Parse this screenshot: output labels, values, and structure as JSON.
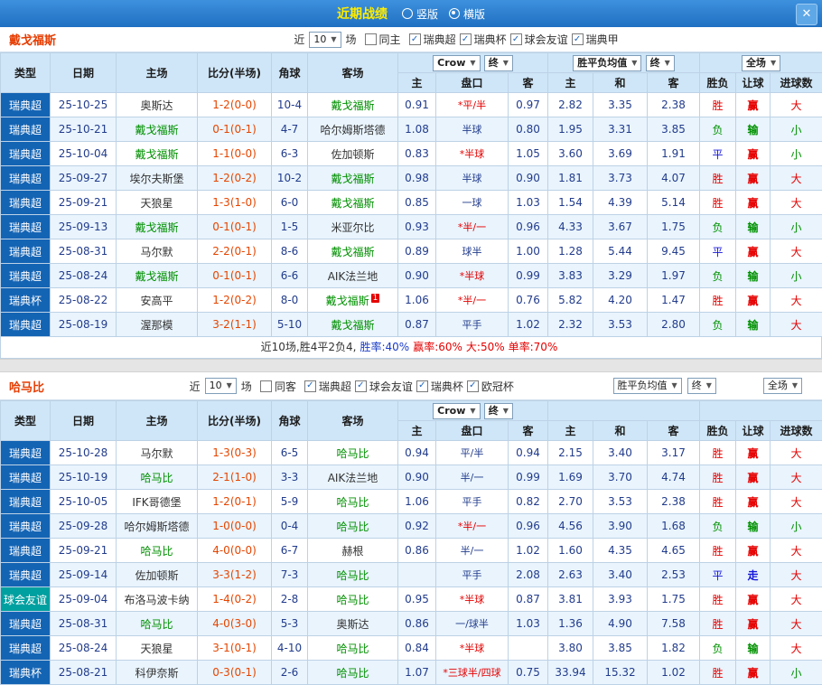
{
  "topbar": {
    "title": "近期战绩",
    "radios": [
      {
        "label": "竖版",
        "checked": false
      },
      {
        "label": "横版",
        "checked": true
      }
    ],
    "close": "✕"
  },
  "header": {
    "near_label": "近",
    "games_label": "场",
    "cols": [
      "类型",
      "日期",
      "主场",
      "比分(半场)",
      "角球",
      "客场"
    ],
    "sub": [
      "主",
      "盘口",
      "客",
      "主",
      "和",
      "客",
      "胜负",
      "让球",
      "进球数"
    ],
    "crow": "Crow",
    "final": "终",
    "avg": "胜平负均值",
    "full": "全场"
  },
  "league_colors": {
    "瑞典超": "#1464b4",
    "瑞典杯": "#1464b4",
    "瑞典甲": "#1464b4",
    "欧冠杯": "#1464b4",
    "球会友谊": "#00a0a0",
    "default": "#1464b4"
  },
  "sections": [
    {
      "team": "戴戈福斯",
      "filter": {
        "count": "10",
        "same_label": "同主",
        "same_checked": false,
        "leagues": [
          {
            "label": "瑞典超",
            "checked": true
          },
          {
            "label": "瑞典杯",
            "checked": true
          },
          {
            "label": "球会友谊",
            "checked": true
          },
          {
            "label": "瑞典甲",
            "checked": true
          }
        ]
      },
      "rows": [
        {
          "league": "瑞典超",
          "date": "25-10-25",
          "home": "奥斯达",
          "home_subject": false,
          "score": "1-2(0-0)",
          "corner": "10-4",
          "away": "戴戈福斯",
          "away_subject": true,
          "badge": "",
          "o1": "0.91",
          "pan": "*平/半",
          "o2": "0.97",
          "a1": "2.82",
          "a2": "3.35",
          "a3": "2.38",
          "r1": "胜",
          "r2": "赢",
          "r3": "大"
        },
        {
          "league": "瑞典超",
          "date": "25-10-21",
          "home": "戴戈福斯",
          "home_subject": true,
          "score": "0-1(0-1)",
          "corner": "4-7",
          "away": "哈尔姆斯塔德",
          "away_subject": false,
          "badge": "",
          "o1": "1.08",
          "pan": "半球",
          "o2": "0.80",
          "a1": "1.95",
          "a2": "3.31",
          "a3": "3.85",
          "r1": "负",
          "r2": "输",
          "r3": "小"
        },
        {
          "league": "瑞典超",
          "date": "25-10-04",
          "home": "戴戈福斯",
          "home_subject": true,
          "score": "1-1(0-0)",
          "corner": "6-3",
          "away": "佐加顿斯",
          "away_subject": false,
          "badge": "",
          "o1": "0.83",
          "pan": "*半球",
          "o2": "1.05",
          "a1": "3.60",
          "a2": "3.69",
          "a3": "1.91",
          "r1": "平",
          "r2": "赢",
          "r3": "小"
        },
        {
          "league": "瑞典超",
          "date": "25-09-27",
          "home": "埃尔夫斯堡",
          "home_subject": false,
          "score": "1-2(0-2)",
          "corner": "10-2",
          "away": "戴戈福斯",
          "away_subject": true,
          "badge": "",
          "o1": "0.98",
          "pan": "半球",
          "o2": "0.90",
          "a1": "1.81",
          "a2": "3.73",
          "a3": "4.07",
          "r1": "胜",
          "r2": "赢",
          "r3": "大"
        },
        {
          "league": "瑞典超",
          "date": "25-09-21",
          "home": "天狼星",
          "home_subject": false,
          "score": "1-3(1-0)",
          "corner": "6-0",
          "away": "戴戈福斯",
          "away_subject": true,
          "badge": "",
          "o1": "0.85",
          "pan": "一球",
          "o2": "1.03",
          "a1": "1.54",
          "a2": "4.39",
          "a3": "5.14",
          "r1": "胜",
          "r2": "赢",
          "r3": "大"
        },
        {
          "league": "瑞典超",
          "date": "25-09-13",
          "home": "戴戈福斯",
          "home_subject": true,
          "score": "0-1(0-1)",
          "corner": "1-5",
          "away": "米亚尔比",
          "away_subject": false,
          "badge": "",
          "o1": "0.93",
          "pan": "*半/一",
          "o2": "0.96",
          "a1": "4.33",
          "a2": "3.67",
          "a3": "1.75",
          "r1": "负",
          "r2": "输",
          "r3": "小"
        },
        {
          "league": "瑞典超",
          "date": "25-08-31",
          "home": "马尔默",
          "home_subject": false,
          "score": "2-2(0-1)",
          "corner": "8-6",
          "away": "戴戈福斯",
          "away_subject": true,
          "badge": "",
          "o1": "0.89",
          "pan": "球半",
          "o2": "1.00",
          "a1": "1.28",
          "a2": "5.44",
          "a3": "9.45",
          "r1": "平",
          "r2": "赢",
          "r3": "大"
        },
        {
          "league": "瑞典超",
          "date": "25-08-24",
          "home": "戴戈福斯",
          "home_subject": true,
          "score": "0-1(0-1)",
          "corner": "6-6",
          "away": "AIK法兰地",
          "away_subject": false,
          "badge": "",
          "o1": "0.90",
          "pan": "*半球",
          "o2": "0.99",
          "a1": "3.83",
          "a2": "3.29",
          "a3": "1.97",
          "r1": "负",
          "r2": "输",
          "r3": "小"
        },
        {
          "league": "瑞典杯",
          "date": "25-08-22",
          "home": "安高平",
          "home_subject": false,
          "score": "1-2(0-2)",
          "corner": "8-0",
          "away": "戴戈福斯",
          "away_subject": true,
          "badge": "1",
          "o1": "1.06",
          "pan": "*半/一",
          "o2": "0.76",
          "a1": "5.82",
          "a2": "4.20",
          "a3": "1.47",
          "r1": "胜",
          "r2": "赢",
          "r3": "大"
        },
        {
          "league": "瑞典超",
          "date": "25-08-19",
          "home": "渥那模",
          "home_subject": false,
          "score": "3-2(1-1)",
          "corner": "5-10",
          "away": "戴戈福斯",
          "away_subject": true,
          "badge": "",
          "o1": "0.87",
          "pan": "平手",
          "o2": "1.02",
          "a1": "2.32",
          "a2": "3.53",
          "a3": "2.80",
          "r1": "负",
          "r2": "输",
          "r3": "大"
        }
      ],
      "summary": [
        {
          "text": "近10场,胜4平2负4,",
          "color": "#333333"
        },
        {
          "text": "胜率:40%",
          "color": "#1a3cc8"
        },
        {
          "text": "赢率:60%",
          "color": "#e60000"
        },
        {
          "text": "大:50%",
          "color": "#e60000"
        },
        {
          "text": "单率:70%",
          "color": "#e60000"
        }
      ]
    },
    {
      "team": "哈马比",
      "filter": {
        "count": "10",
        "same_label": "同客",
        "same_checked": false,
        "leagues": [
          {
            "label": "瑞典超",
            "checked": true
          },
          {
            "label": "球会友谊",
            "checked": true
          },
          {
            "label": "瑞典杯",
            "checked": true
          },
          {
            "label": "欧冠杯",
            "checked": true
          }
        ]
      },
      "rows": [
        {
          "league": "瑞典超",
          "date": "25-10-28",
          "home": "马尔默",
          "home_subject": false,
          "score": "1-3(0-3)",
          "corner": "6-5",
          "away": "哈马比",
          "away_subject": true,
          "badge": "",
          "o1": "0.94",
          "pan": "平/半",
          "o2": "0.94",
          "a1": "2.15",
          "a2": "3.40",
          "a3": "3.17",
          "r1": "胜",
          "r2": "赢",
          "r3": "大"
        },
        {
          "league": "瑞典超",
          "date": "25-10-19",
          "home": "哈马比",
          "home_subject": true,
          "score": "2-1(1-0)",
          "corner": "3-3",
          "away": "AIK法兰地",
          "away_subject": false,
          "badge": "",
          "o1": "0.90",
          "pan": "半/一",
          "o2": "0.99",
          "a1": "1.69",
          "a2": "3.70",
          "a3": "4.74",
          "r1": "胜",
          "r2": "赢",
          "r3": "大"
        },
        {
          "league": "瑞典超",
          "date": "25-10-05",
          "home": "IFK哥德堡",
          "home_subject": false,
          "score": "1-2(0-1)",
          "corner": "5-9",
          "away": "哈马比",
          "away_subject": true,
          "badge": "",
          "o1": "1.06",
          "pan": "平手",
          "o2": "0.82",
          "a1": "2.70",
          "a2": "3.53",
          "a3": "2.38",
          "r1": "胜",
          "r2": "赢",
          "r3": "大"
        },
        {
          "league": "瑞典超",
          "date": "25-09-28",
          "home": "哈尔姆斯塔德",
          "home_subject": false,
          "score": "1-0(0-0)",
          "corner": "0-4",
          "away": "哈马比",
          "away_subject": true,
          "badge": "",
          "o1": "0.92",
          "pan": "*半/一",
          "o2": "0.96",
          "a1": "4.56",
          "a2": "3.90",
          "a3": "1.68",
          "r1": "负",
          "r2": "输",
          "r3": "小"
        },
        {
          "league": "瑞典超",
          "date": "25-09-21",
          "home": "哈马比",
          "home_subject": true,
          "score": "4-0(0-0)",
          "corner": "6-7",
          "away": "赫根",
          "away_subject": false,
          "badge": "",
          "o1": "0.86",
          "pan": "半/一",
          "o2": "1.02",
          "a1": "1.60",
          "a2": "4.35",
          "a3": "4.65",
          "r1": "胜",
          "r2": "赢",
          "r3": "大"
        },
        {
          "league": "瑞典超",
          "date": "25-09-14",
          "home": "佐加顿斯",
          "home_subject": false,
          "score": "3-3(1-2)",
          "corner": "7-3",
          "away": "哈马比",
          "away_subject": true,
          "badge": "",
          "o1": "",
          "pan": "平手",
          "o2": "2.08",
          "a1": "2.63",
          "a2": "3.40",
          "a3": "2.53",
          "r1": "平",
          "r2": "走",
          "r3": "大"
        },
        {
          "league": "球会友谊",
          "date": "25-09-04",
          "home": "布洛马波卡纳",
          "home_subject": false,
          "score": "1-4(0-2)",
          "corner": "2-8",
          "away": "哈马比",
          "away_subject": true,
          "badge": "",
          "o1": "0.95",
          "pan": "*半球",
          "o2": "0.87",
          "a1": "3.81",
          "a2": "3.93",
          "a3": "1.75",
          "r1": "胜",
          "r2": "赢",
          "r3": "大"
        },
        {
          "league": "瑞典超",
          "date": "25-08-31",
          "home": "哈马比",
          "home_subject": true,
          "score": "4-0(3-0)",
          "corner": "5-3",
          "away": "奥斯达",
          "away_subject": false,
          "badge": "",
          "o1": "0.86",
          "pan": "一/球半",
          "o2": "1.03",
          "a1": "1.36",
          "a2": "4.90",
          "a3": "7.58",
          "r1": "胜",
          "r2": "赢",
          "r3": "大"
        },
        {
          "league": "瑞典超",
          "date": "25-08-24",
          "home": "天狼星",
          "home_subject": false,
          "score": "3-1(0-1)",
          "corner": "4-10",
          "away": "哈马比",
          "away_subject": true,
          "badge": "",
          "o1": "0.84",
          "pan": "*半球",
          "o2": "",
          "a1": "3.80",
          "a2": "3.85",
          "a3": "1.82",
          "r1": "负",
          "r2": "输",
          "r3": "大"
        },
        {
          "league": "瑞典杯",
          "date": "25-08-21",
          "home": "科伊奈斯",
          "home_subject": false,
          "score": "0-3(0-1)",
          "corner": "2-6",
          "away": "哈马比",
          "away_subject": true,
          "badge": "",
          "o1": "1.07",
          "pan": "*三球半/四球",
          "o2": "0.75",
          "a1": "33.94",
          "a2": "15.32",
          "a3": "1.02",
          "r1": "胜",
          "r2": "赢",
          "r3": "小"
        }
      ],
      "summary": []
    }
  ]
}
